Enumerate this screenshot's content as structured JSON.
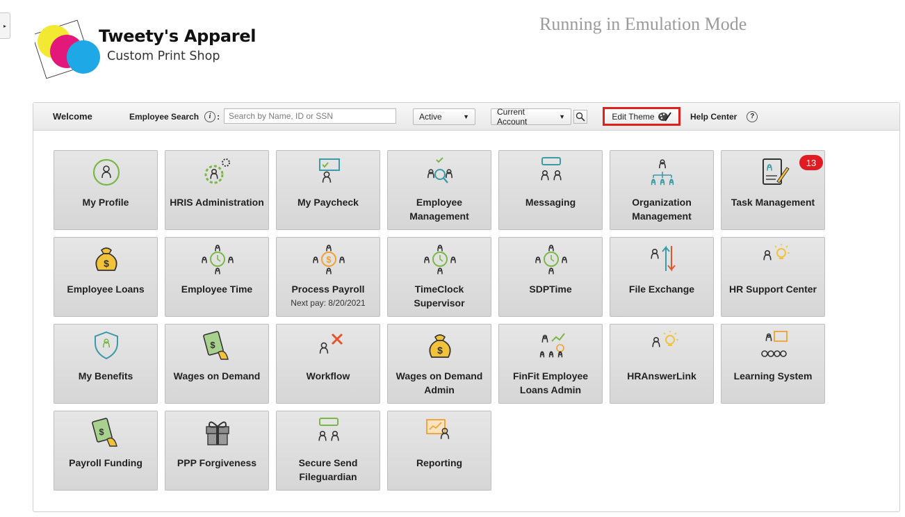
{
  "header": {
    "logo_title": "Tweety's Apparel",
    "logo_subtitle": "Custom Print Shop",
    "emulation_text": "Running in Emulation Mode"
  },
  "toolbar": {
    "welcome": "Welcome",
    "employee_search_label": "Employee Search",
    "info_glyph": "i",
    "search_placeholder": "Search by Name, ID or SSN",
    "status_select": "Active",
    "account_select": "Current Account",
    "edit_theme": "Edit Theme",
    "help_center": "Help Center",
    "help_glyph": "?"
  },
  "tiles": [
    {
      "label": "My Profile",
      "icon": "profile-icon"
    },
    {
      "label": "HRIS Administration",
      "icon": "hris-admin-icon"
    },
    {
      "label": "My Paycheck",
      "icon": "paycheck-icon"
    },
    {
      "label": "Employee Management",
      "icon": "employee-management-icon"
    },
    {
      "label": "Messaging",
      "icon": "messaging-icon"
    },
    {
      "label": "Organization Management",
      "icon": "org-chart-icon"
    },
    {
      "label": "Task Management",
      "icon": "task-clipboard-icon",
      "badge": "13"
    },
    {
      "label": "Employee Loans",
      "icon": "money-bag-icon"
    },
    {
      "label": "Employee Time",
      "icon": "time-clock-icon"
    },
    {
      "label": "Process Payroll",
      "sub": "Next pay: 8/20/2021",
      "icon": "payroll-cycle-icon"
    },
    {
      "label": "TimeClock Supervisor",
      "icon": "time-clock-icon"
    },
    {
      "label": "SDPTime",
      "icon": "time-clock-icon"
    },
    {
      "label": "File Exchange",
      "icon": "file-exchange-icon"
    },
    {
      "label": "HR Support Center",
      "icon": "lightbulb-person-icon"
    },
    {
      "label": "My Benefits",
      "icon": "shield-person-icon"
    },
    {
      "label": "Wages on Demand",
      "icon": "cash-hand-icon"
    },
    {
      "label": "Workflow",
      "icon": "workflow-tools-icon"
    },
    {
      "label": "Wages on Demand Admin",
      "icon": "money-bag-icon"
    },
    {
      "label": "FinFit Employee Loans Admin",
      "icon": "finance-chart-icon"
    },
    {
      "label": "HRAnswerLink",
      "icon": "lightbulb-person-icon"
    },
    {
      "label": "Learning System",
      "icon": "presentation-icon"
    },
    {
      "label": "Payroll Funding",
      "icon": "cash-hand-icon"
    },
    {
      "label": "PPP Forgiveness",
      "icon": "gift-icon"
    },
    {
      "label": "Secure Send Fileguardian",
      "icon": "secure-chat-icon"
    },
    {
      "label": "Reporting",
      "icon": "report-chart-icon"
    }
  ]
}
